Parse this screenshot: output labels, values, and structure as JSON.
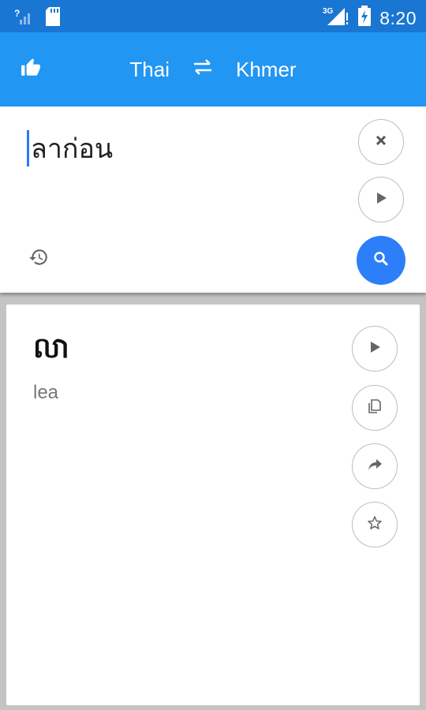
{
  "status_bar": {
    "time": "8:20",
    "network_label": "3G"
  },
  "app_bar": {
    "source_language": "Thai",
    "target_language": "Khmer",
    "swap_glyph": "⇄"
  },
  "input": {
    "text": "ลาก่อน"
  },
  "result": {
    "translation": "លា",
    "transliteration": "lea"
  },
  "colors": {
    "status_bar": "#1976d2",
    "app_bar": "#2196f3",
    "accent_button": "#2d7ff9",
    "background": "#c4c4c4"
  },
  "icons": {
    "like": "thumbs-up-icon",
    "swap": "swap-icon",
    "clear": "close-icon",
    "play": "play-icon",
    "search": "search-icon",
    "history": "history-icon",
    "copy": "copy-icon",
    "share": "share-icon",
    "favorite": "star-icon"
  }
}
